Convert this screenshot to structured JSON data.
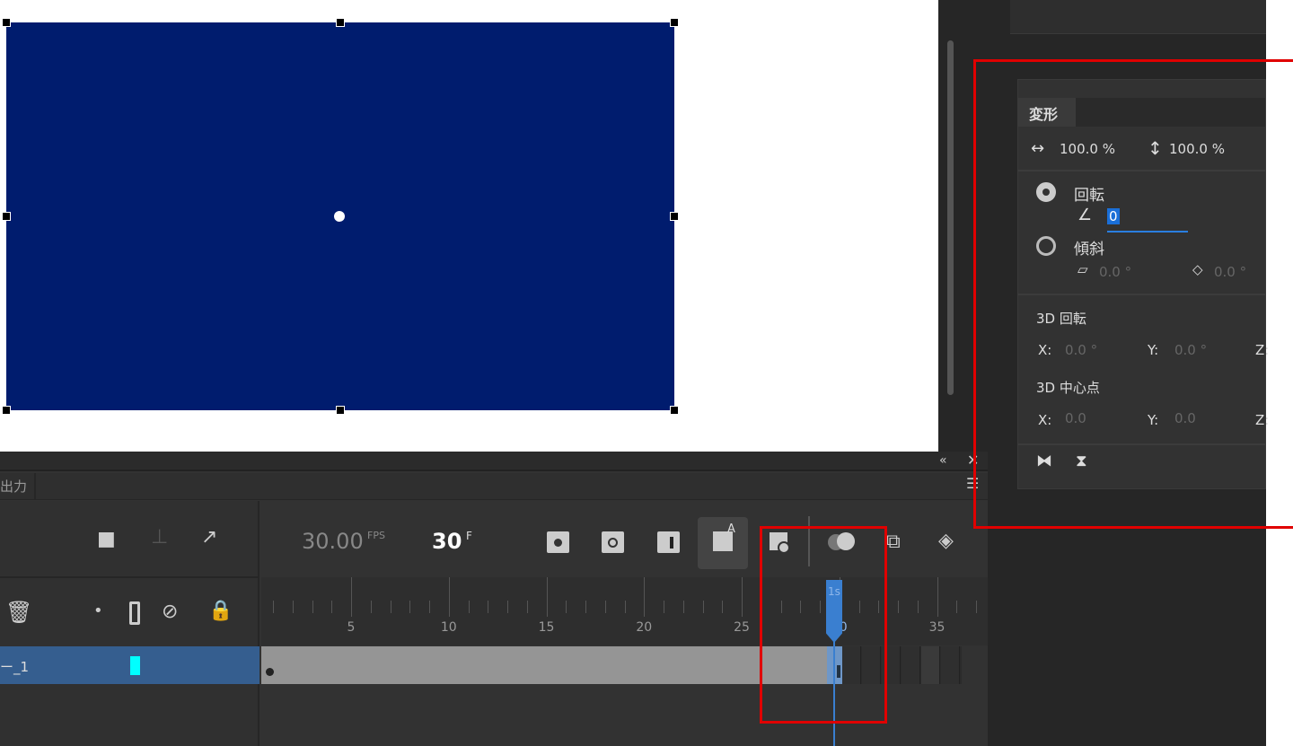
{
  "transform_panel": {
    "tab": "変形",
    "scale_w": "100.0 %",
    "scale_h": "100.0 %",
    "rotate_label": "回転",
    "rotate_value": "0",
    "skew_label": "傾斜",
    "skew_h": "0.0 °",
    "skew_v": "0.0 °",
    "rot3d_label": "3D 回転",
    "rot3d_x_label": "X:",
    "rot3d_x": "0.0 °",
    "rot3d_y_label": "Y:",
    "rot3d_y": "0.0 °",
    "rot3d_z_label": "Z:",
    "center3d_label": "3D 中心点",
    "center3d_x_label": "X:",
    "center3d_x": "0.0",
    "center3d_y_label": "Y:",
    "center3d_y": "0.0",
    "center3d_z_label": "Z:"
  },
  "timeline": {
    "tab_partial": "出力",
    "fps": "30.00",
    "fps_unit": "FPS",
    "frame": "30",
    "frame_unit": "F",
    "layer_name": "ー_1",
    "ruler_labels": [
      "5",
      "10",
      "15",
      "20",
      "25",
      "30",
      "35"
    ],
    "playhead_sec": "1s",
    "current_frame": 30,
    "last_frame": 30
  },
  "colors": {
    "shape": "#001c6e",
    "selection": "#3a7fd0",
    "highlight": "#e00000"
  }
}
